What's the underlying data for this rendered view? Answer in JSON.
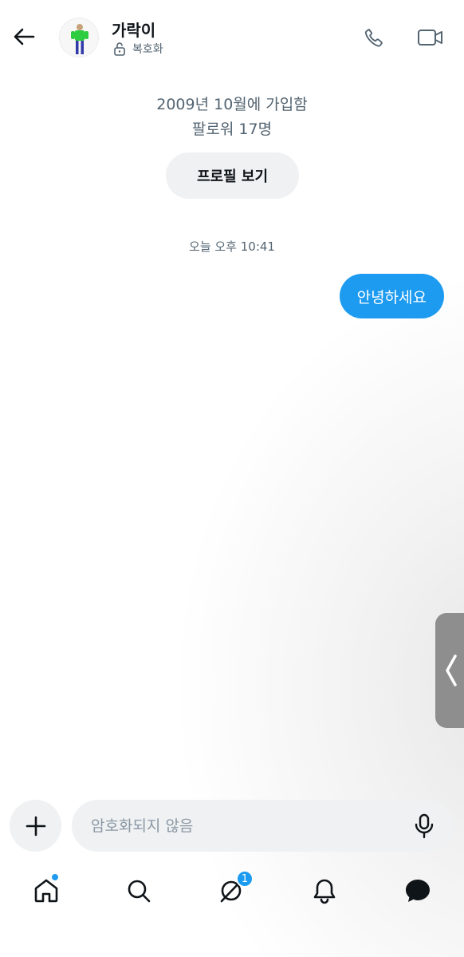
{
  "header": {
    "contact_name": "가락이",
    "encryption_label": "복호화"
  },
  "profile_info": {
    "joined": "2009년 10월에 가입함",
    "followers": "팔로워 17명",
    "view_profile_label": "프로필 보기"
  },
  "conversation": {
    "timestamp": "오늘 오후 10:41",
    "messages": [
      {
        "text": "안녕하세요",
        "direction": "outgoing"
      }
    ]
  },
  "composer": {
    "placeholder": "암호화되지 않음",
    "value": ""
  },
  "bottom_nav": {
    "items": [
      {
        "icon": "home-icon",
        "has_dot": true
      },
      {
        "icon": "search-icon"
      },
      {
        "icon": "grok-icon",
        "badge": "1"
      },
      {
        "icon": "notifications-icon"
      },
      {
        "icon": "messages-icon",
        "active": true
      }
    ]
  },
  "colors": {
    "accent": "#1d9bf0",
    "bubble_outgoing": "#1d9bf0",
    "pill_background": "#eff1f2",
    "secondary_text": "#536471"
  }
}
